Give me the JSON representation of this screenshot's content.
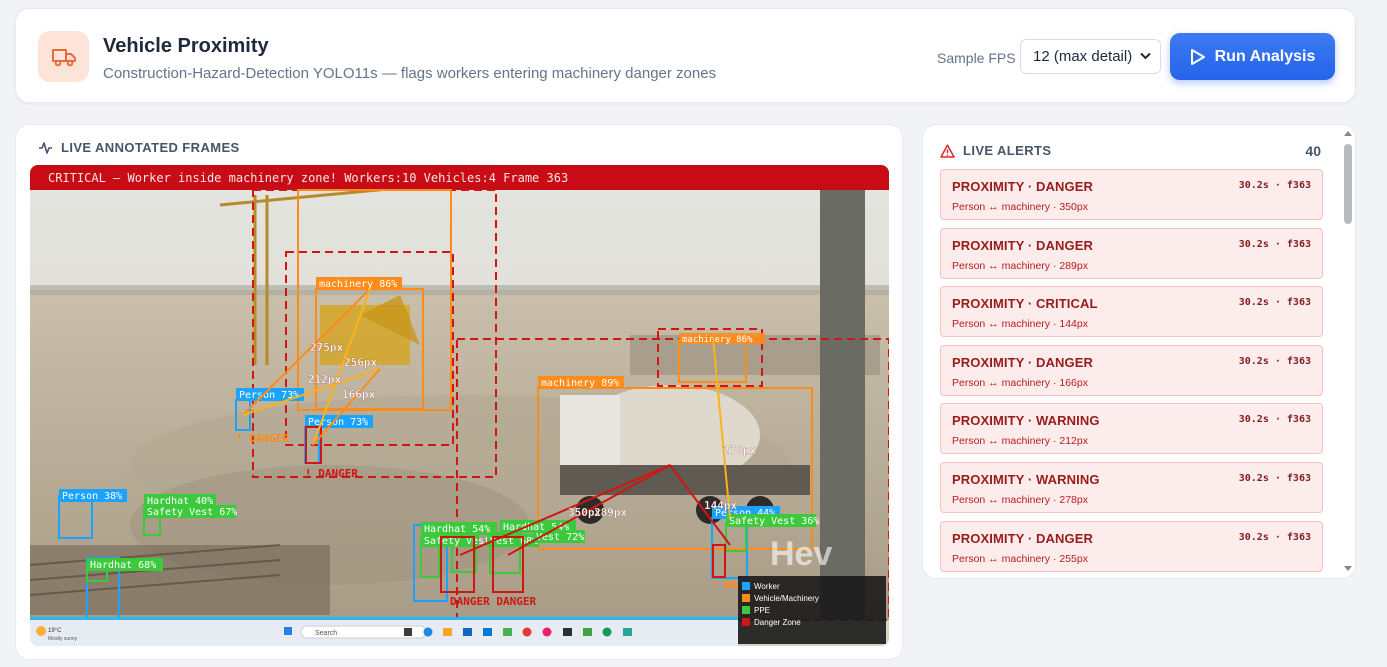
{
  "header": {
    "title": "Vehicle Proximity",
    "subtitle": "Construction-Hazard-Detection YOLO11s — flags workers entering machinery danger zones",
    "fps_label": "Sample FPS",
    "fps_value": "12 (max detail)",
    "run_label": "Run Analysis",
    "logo_icon": "truck-icon"
  },
  "frames": {
    "title": "LIVE ANNOTATED FRAMES",
    "banner": "CRITICAL — Worker inside machinery zone!  Workers:10  Vehicles:4  Frame 363",
    "labels": {
      "machinery_crane": "machinery 86%",
      "machinery_mixer": "machinery 89%",
      "machinery_far": "machinery 86%",
      "person_left": "Person 73%",
      "person_mid": "Person 73%",
      "person_bl": "Person 38%",
      "person_right": "Person 44%",
      "hardhat_1": "Hardhat 40%",
      "vest_1": "Safety Vest 67%",
      "hardhat_2": "Hardhat 68%",
      "hardhat_3": "Hardhat 54%",
      "vest_2": "Safety Vest",
      "hardhat_4": "Hardhat 54%",
      "vest_3": "Vest 68%",
      "vest_4": "Vest 72%",
      "vest_right": "Safety Vest 36%",
      "danger_1": "! DANGER",
      "danger_2": "! DANGER",
      "danger_3": "DANGER DANGER",
      "warn_right": "! WA",
      "dist_1": "275px",
      "dist_2": "256px",
      "dist_3": "212px",
      "dist_4": "166px",
      "dist_5": "278px",
      "dist_6": "144px",
      "dist_7": "350px",
      "dist_8": "289px"
    },
    "legend": [
      {
        "label": "Worker",
        "color": "#1aa3ff"
      },
      {
        "label": "Vehicle/Machinery",
        "color": "#ff8c1a"
      },
      {
        "label": "PPE",
        "color": "#3cc93c"
      },
      {
        "label": "Danger Zone",
        "color": "#d11414"
      }
    ],
    "taskbar": {
      "weather": "19°C",
      "weather_sub": "Mostly sunny",
      "search": "Search"
    },
    "watermark": "Hev"
  },
  "alerts": {
    "title": "LIVE ALERTS",
    "count": "40",
    "items": [
      {
        "title": "PROXIMITY · DANGER",
        "meta": "30.2s · f363",
        "sub": "Person ↔ machinery · 350px"
      },
      {
        "title": "PROXIMITY · DANGER",
        "meta": "30.2s · f363",
        "sub": "Person ↔ machinery · 289px"
      },
      {
        "title": "PROXIMITY · CRITICAL",
        "meta": "30.2s · f363",
        "sub": "Person ↔ machinery · 144px"
      },
      {
        "title": "PROXIMITY · DANGER",
        "meta": "30.2s · f363",
        "sub": "Person ↔ machinery · 166px"
      },
      {
        "title": "PROXIMITY · WARNING",
        "meta": "30.2s · f363",
        "sub": "Person ↔ machinery · 212px"
      },
      {
        "title": "PROXIMITY · WARNING",
        "meta": "30.2s · f363",
        "sub": "Person ↔ machinery · 278px"
      },
      {
        "title": "PROXIMITY · DANGER",
        "meta": "30.2s · f363",
        "sub": "Person ↔ machinery · 255px"
      }
    ]
  },
  "colors": {
    "accent": "#2563eb",
    "alert_bg": "#fdecec",
    "alert_text": "#991b1b",
    "worker": "#1aa3ff",
    "machinery": "#ff8c1a",
    "ppe": "#3cc93c",
    "danger": "#d11414"
  }
}
